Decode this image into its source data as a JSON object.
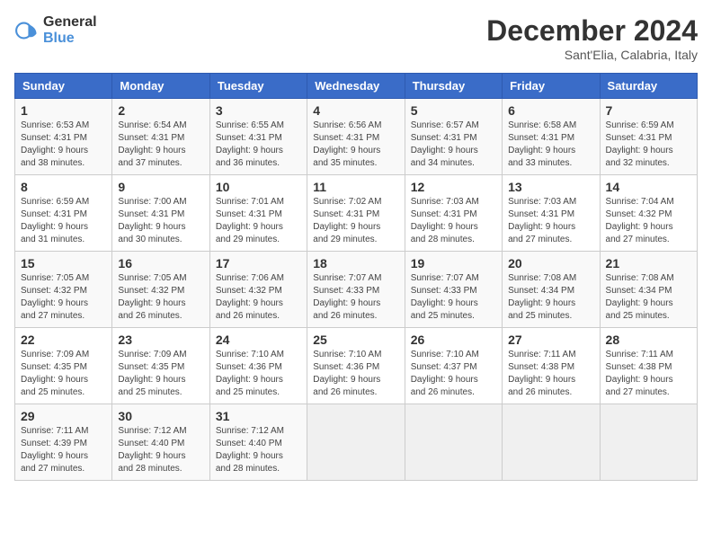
{
  "header": {
    "logo_line1": "General",
    "logo_line2": "Blue",
    "title": "December 2024",
    "location": "Sant'Elia, Calabria, Italy"
  },
  "days_of_week": [
    "Sunday",
    "Monday",
    "Tuesday",
    "Wednesday",
    "Thursday",
    "Friday",
    "Saturday"
  ],
  "weeks": [
    [
      {
        "day": "1",
        "info": "Sunrise: 6:53 AM\nSunset: 4:31 PM\nDaylight: 9 hours\nand 38 minutes."
      },
      {
        "day": "2",
        "info": "Sunrise: 6:54 AM\nSunset: 4:31 PM\nDaylight: 9 hours\nand 37 minutes."
      },
      {
        "day": "3",
        "info": "Sunrise: 6:55 AM\nSunset: 4:31 PM\nDaylight: 9 hours\nand 36 minutes."
      },
      {
        "day": "4",
        "info": "Sunrise: 6:56 AM\nSunset: 4:31 PM\nDaylight: 9 hours\nand 35 minutes."
      },
      {
        "day": "5",
        "info": "Sunrise: 6:57 AM\nSunset: 4:31 PM\nDaylight: 9 hours\nand 34 minutes."
      },
      {
        "day": "6",
        "info": "Sunrise: 6:58 AM\nSunset: 4:31 PM\nDaylight: 9 hours\nand 33 minutes."
      },
      {
        "day": "7",
        "info": "Sunrise: 6:59 AM\nSunset: 4:31 PM\nDaylight: 9 hours\nand 32 minutes."
      }
    ],
    [
      {
        "day": "8",
        "info": "Sunrise: 6:59 AM\nSunset: 4:31 PM\nDaylight: 9 hours\nand 31 minutes."
      },
      {
        "day": "9",
        "info": "Sunrise: 7:00 AM\nSunset: 4:31 PM\nDaylight: 9 hours\nand 30 minutes."
      },
      {
        "day": "10",
        "info": "Sunrise: 7:01 AM\nSunset: 4:31 PM\nDaylight: 9 hours\nand 29 minutes."
      },
      {
        "day": "11",
        "info": "Sunrise: 7:02 AM\nSunset: 4:31 PM\nDaylight: 9 hours\nand 29 minutes."
      },
      {
        "day": "12",
        "info": "Sunrise: 7:03 AM\nSunset: 4:31 PM\nDaylight: 9 hours\nand 28 minutes."
      },
      {
        "day": "13",
        "info": "Sunrise: 7:03 AM\nSunset: 4:31 PM\nDaylight: 9 hours\nand 27 minutes."
      },
      {
        "day": "14",
        "info": "Sunrise: 7:04 AM\nSunset: 4:32 PM\nDaylight: 9 hours\nand 27 minutes."
      }
    ],
    [
      {
        "day": "15",
        "info": "Sunrise: 7:05 AM\nSunset: 4:32 PM\nDaylight: 9 hours\nand 27 minutes."
      },
      {
        "day": "16",
        "info": "Sunrise: 7:05 AM\nSunset: 4:32 PM\nDaylight: 9 hours\nand 26 minutes."
      },
      {
        "day": "17",
        "info": "Sunrise: 7:06 AM\nSunset: 4:32 PM\nDaylight: 9 hours\nand 26 minutes."
      },
      {
        "day": "18",
        "info": "Sunrise: 7:07 AM\nSunset: 4:33 PM\nDaylight: 9 hours\nand 26 minutes."
      },
      {
        "day": "19",
        "info": "Sunrise: 7:07 AM\nSunset: 4:33 PM\nDaylight: 9 hours\nand 25 minutes."
      },
      {
        "day": "20",
        "info": "Sunrise: 7:08 AM\nSunset: 4:34 PM\nDaylight: 9 hours\nand 25 minutes."
      },
      {
        "day": "21",
        "info": "Sunrise: 7:08 AM\nSunset: 4:34 PM\nDaylight: 9 hours\nand 25 minutes."
      }
    ],
    [
      {
        "day": "22",
        "info": "Sunrise: 7:09 AM\nSunset: 4:35 PM\nDaylight: 9 hours\nand 25 minutes."
      },
      {
        "day": "23",
        "info": "Sunrise: 7:09 AM\nSunset: 4:35 PM\nDaylight: 9 hours\nand 25 minutes."
      },
      {
        "day": "24",
        "info": "Sunrise: 7:10 AM\nSunset: 4:36 PM\nDaylight: 9 hours\nand 25 minutes."
      },
      {
        "day": "25",
        "info": "Sunrise: 7:10 AM\nSunset: 4:36 PM\nDaylight: 9 hours\nand 26 minutes."
      },
      {
        "day": "26",
        "info": "Sunrise: 7:10 AM\nSunset: 4:37 PM\nDaylight: 9 hours\nand 26 minutes."
      },
      {
        "day": "27",
        "info": "Sunrise: 7:11 AM\nSunset: 4:38 PM\nDaylight: 9 hours\nand 26 minutes."
      },
      {
        "day": "28",
        "info": "Sunrise: 7:11 AM\nSunset: 4:38 PM\nDaylight: 9 hours\nand 27 minutes."
      }
    ],
    [
      {
        "day": "29",
        "info": "Sunrise: 7:11 AM\nSunset: 4:39 PM\nDaylight: 9 hours\nand 27 minutes."
      },
      {
        "day": "30",
        "info": "Sunrise: 7:12 AM\nSunset: 4:40 PM\nDaylight: 9 hours\nand 28 minutes."
      },
      {
        "day": "31",
        "info": "Sunrise: 7:12 AM\nSunset: 4:40 PM\nDaylight: 9 hours\nand 28 minutes."
      },
      {
        "day": "",
        "info": ""
      },
      {
        "day": "",
        "info": ""
      },
      {
        "day": "",
        "info": ""
      },
      {
        "day": "",
        "info": ""
      }
    ]
  ]
}
